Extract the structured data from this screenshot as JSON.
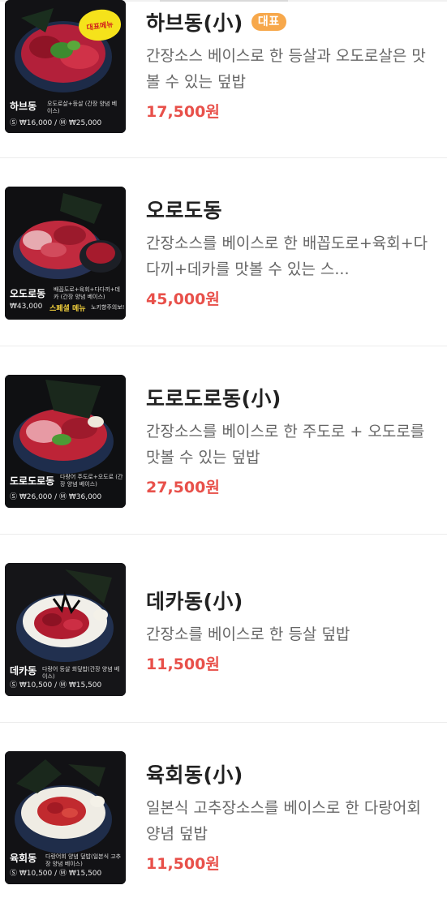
{
  "menu": [
    {
      "name": "하브동(小)",
      "badge": "대표",
      "description": "간장소스 베이스로 한 등살과 오도로살은 맛볼 수 있는 덮밥",
      "price": "17,500원",
      "image": {
        "sticker": "대표메뉴",
        "caption_name": "하브동",
        "caption_desc": "오도로살+등살 (간장 양념 베이스)",
        "caption_price": "Ⓢ ₩16,000 / Ⓜ ₩25,000"
      }
    },
    {
      "name": "오로도동",
      "badge": "",
      "description": "간장소스를 베이스로 한 배꼽도로+육회+다다끼+데카를 맛볼 수 있는 스...",
      "price": "45,000원",
      "image": {
        "caption_name": "오도로동",
        "caption_desc": "배꼽도로+육회+다다끼+데카 (간장 양념 베이스)",
        "caption_price": "₩43,000",
        "caption_special": "스페셜 메뉴",
        "caption_note": "노키향주의보!"
      }
    },
    {
      "name": "도로도로동(小)",
      "badge": "",
      "description": "간장소스를 베이스로 한 주도로 + 오도로를 맛볼 수 있는 덮밥",
      "price": "27,500원",
      "image": {
        "caption_name": "도로도로동",
        "caption_desc": "다랑어 주도로+오도로 (간장 양념 베이스)",
        "caption_price": "Ⓢ ₩26,000 / Ⓜ ₩36,000"
      }
    },
    {
      "name": "데카동(小)",
      "badge": "",
      "description": "간장소를 베이스로 한 등살 덮밥",
      "price": "11,500원",
      "image": {
        "caption_name": "데카동",
        "caption_desc": "다랑어 등살 회덮밥(간장 양념 베이스)",
        "caption_price": "Ⓢ ₩10,500 / Ⓜ ₩15,500"
      }
    },
    {
      "name": "육회동(小)",
      "badge": "",
      "description": "일본식 고추장소스를 베이스로 한 다랑어회 양념 덮밥",
      "price": "11,500원",
      "image": {
        "caption_name": "육회동",
        "caption_desc": "다랑어회 양념 덮밥(일본식 고추장 양념 베이스)",
        "caption_price": "Ⓢ ₩10,500 / Ⓜ ₩15,500"
      }
    }
  ],
  "colors": {
    "price": "#e8504a",
    "badge": "#f7a84b",
    "title": "#222222",
    "desc": "#666666"
  }
}
